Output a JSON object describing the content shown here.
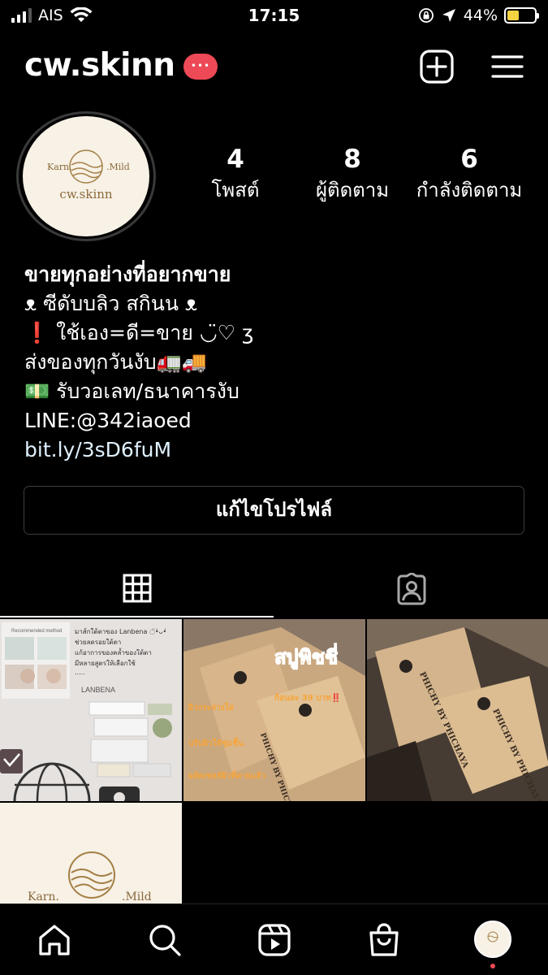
{
  "status_bar": {
    "carrier": "AIS",
    "time": "17:15",
    "battery_percent": "44%",
    "battery_level": 0.44,
    "icons": [
      "signal-icon",
      "wifi-icon",
      "orientation-lock-icon",
      "location-icon",
      "battery-icon"
    ]
  },
  "header": {
    "username": "cw.skinn",
    "icons": [
      "new-post-icon",
      "menu-icon"
    ]
  },
  "profile": {
    "avatar": {
      "brand_left": "Karn.",
      "brand_right": ".Mild",
      "brand_name": "cw.skinn"
    },
    "stats": [
      {
        "value": "4",
        "label": "โพสต์"
      },
      {
        "value": "8",
        "label": "ผู้ติดตาม"
      },
      {
        "value": "6",
        "label": "กำลังติดตาม"
      }
    ]
  },
  "bio": {
    "name": "ขายทุกอย่างที่อยากขาย",
    "lines": [
      "ᴥ ซีดับบลิว สกินน ᴥ",
      "❗ ใช้เอง=ดี=ขาย ◡̈♡ ʒ",
      "ส่งของทุกวันงับ🚛🚚",
      "💵 รับวอเลท/ธนาคารงับ",
      "LINE:@342iaoed"
    ],
    "link": "bit.ly/3sD6fuM"
  },
  "edit_profile_label": "แก้ไขโปรไฟล์",
  "tabs": [
    {
      "name": "grid",
      "icon": "grid-icon",
      "active": true
    },
    {
      "name": "tagged",
      "icon": "tagged-icon",
      "active": false
    }
  ],
  "posts": {
    "tile1": {
      "method": "Recommended method",
      "caption_lines": [
        "มาส์กใต้ตาของ Lanbena ◌̈•̀ᴗ•́",
        "ช่วยลดรอยใต้ตา",
        "แก้อาการของคล้ำของใต้ตา",
        "มีหลายสูตรให้เลือกใช้",
        "....."
      ],
      "brand": "LANBENA"
    },
    "tile2": {
      "title": "สบู่พิชชี่",
      "price": "ก้อนละ 39 บาท‼️",
      "points": [
        "ผิวกระจ่างใส",
        "ปรับผิวให้ชุ่มชื้น",
        "ผลัดเซลล์ผิวที่ตายแล้ว"
      ],
      "box_text": "PHICHY BY PHICHAYA"
    },
    "tile3": {
      "box_text": "PHICHY BY PHICHAYA"
    },
    "tile4": {
      "brand_left": "Karn.",
      "brand_right": ".Mild"
    }
  },
  "bottom_nav": [
    "home-icon",
    "search-icon",
    "reels-icon",
    "shop-icon",
    "profile-avatar"
  ],
  "colors": {
    "accent": "#ed4956",
    "background": "#000000",
    "avatar_bg": "#f7f1e6",
    "brand_gold": "#8a6a3a"
  }
}
